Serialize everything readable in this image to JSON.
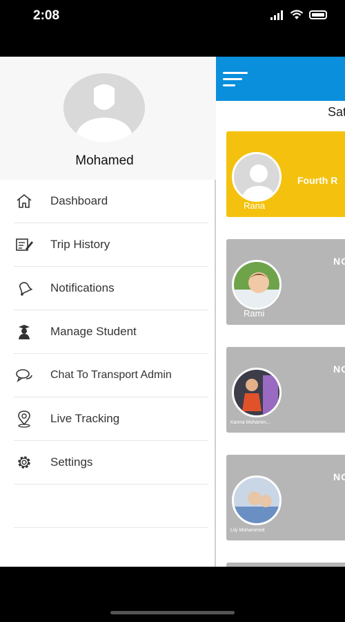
{
  "status": {
    "time": "2:08"
  },
  "drawer": {
    "user_name": "Mohamed",
    "menu": [
      {
        "label": "Dashboard",
        "icon": "home-icon"
      },
      {
        "label": "Trip History",
        "icon": "history-icon"
      },
      {
        "label": "Notifications",
        "icon": "bell-icon"
      },
      {
        "label": "Manage Student",
        "icon": "student-icon"
      },
      {
        "label": "Chat To Transport Admin",
        "icon": "chat-icon"
      },
      {
        "label": "Live Tracking",
        "icon": "location-pin-icon"
      },
      {
        "label": "Settings",
        "icon": "gear-icon"
      }
    ]
  },
  "content": {
    "day_label": "Sat",
    "cards": [
      {
        "name": "Rana",
        "status": "Fourth R",
        "color": "#f4c20e"
      },
      {
        "name": "Rami",
        "status": "NO",
        "color": "#b6b6b6"
      },
      {
        "name": "Karma Mohamm...",
        "status": "NO",
        "color": "#b6b6b6"
      },
      {
        "name": "Lily Mohammed",
        "status": "NO",
        "color": "#b6b6b6"
      }
    ]
  },
  "colors": {
    "appbar": "#0a8fdc",
    "accent_yellow": "#f4c20e",
    "card_gray": "#b6b6b6"
  }
}
